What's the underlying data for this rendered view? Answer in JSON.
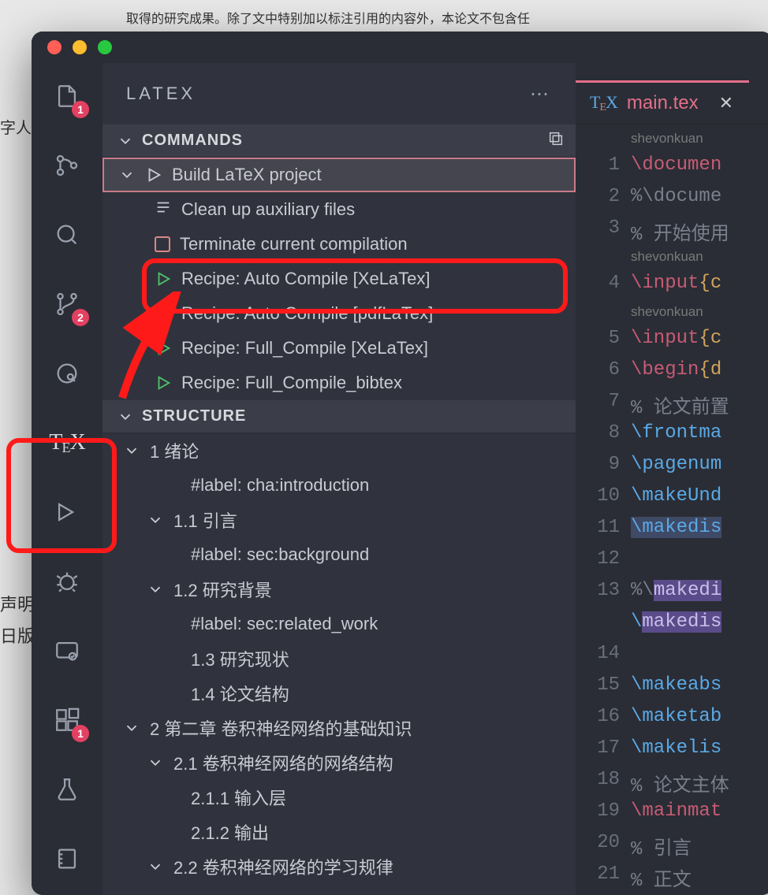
{
  "background_text_top": "取得的研究成果。除了文中特别加以标注引用的内容外，本论文不包含任",
  "background_text_left1": "字人识",
  "background_text_left2": "声明",
  "background_text_left3": "日版",
  "sidebar_title": "LATEX",
  "tab": {
    "filename": "main.tex"
  },
  "activity_badges": {
    "explorer": "1",
    "scm": "2",
    "extensions": "1"
  },
  "commands": {
    "header": "COMMANDS",
    "build": "Build LaTeX project",
    "cleanup": "Clean up auxiliary files",
    "terminate": "Terminate current compilation",
    "recipe_xelatex": "Recipe: Auto Compile [XeLaTex]",
    "recipe_pdflatex": "Recipe: Auto Compile [pdfLaTex]",
    "recipe_full_xelatex": "Recipe: Full_Compile [XeLaTex]",
    "recipe_full_bibtex": "Recipe: Full_Compile_bibtex"
  },
  "structure": {
    "header": "STRUCTURE",
    "items": [
      {
        "depth": 1,
        "chev": true,
        "label": "1 绪论"
      },
      {
        "depth": 3,
        "chev": false,
        "label": "#label: cha:introduction"
      },
      {
        "depth": 2,
        "chev": true,
        "label": "1.1 引言"
      },
      {
        "depth": 3,
        "chev": false,
        "label": "#label: sec:background"
      },
      {
        "depth": 2,
        "chev": true,
        "label": "1.2 研究背景"
      },
      {
        "depth": 3,
        "chev": false,
        "label": "#label: sec:related_work"
      },
      {
        "depth": 3,
        "chev": false,
        "label": "1.3 研究现状"
      },
      {
        "depth": 3,
        "chev": false,
        "label": "1.4 论文结构"
      },
      {
        "depth": 1,
        "chev": true,
        "label": "2 第二章 卷积神经网络的基础知识"
      },
      {
        "depth": 2,
        "chev": true,
        "label": "2.1 卷积神经网络的网络结构"
      },
      {
        "depth": 3,
        "chev": false,
        "label": "2.1.1 输入层"
      },
      {
        "depth": 3,
        "chev": false,
        "label": "2.1.2 输出"
      },
      {
        "depth": 2,
        "chev": true,
        "label": "2.2 卷积神经网络的学习规律"
      }
    ]
  },
  "code": {
    "user": "shevonkuan",
    "lines": [
      {
        "n": "1",
        "t": "\\documen",
        "cls": "cmd2"
      },
      {
        "n": "2",
        "t": "%\\docume",
        "cls": "comment"
      },
      {
        "n": "3",
        "t": "% 开始使用",
        "cls": "comment"
      },
      {
        "n": "",
        "t": "shevonkuan",
        "cls": "user"
      },
      {
        "n": "4",
        "t": "\\input{c",
        "cls": "cmd2-brace"
      },
      {
        "n": "",
        "t": "shevonkuan",
        "cls": "user"
      },
      {
        "n": "5",
        "t": "\\input{c",
        "cls": "cmd2-brace"
      },
      {
        "n": "6",
        "t": "\\begin{d",
        "cls": "cmd2-brace"
      },
      {
        "n": "7",
        "t": "% 论文前置",
        "cls": "comment"
      },
      {
        "n": "8",
        "t": "\\frontma",
        "cls": "cmd"
      },
      {
        "n": "9",
        "t": "\\pagenum",
        "cls": "cmd"
      },
      {
        "n": "10",
        "t": "\\makeUnd",
        "cls": "cmd"
      },
      {
        "n": "11",
        "t": "\\makedis",
        "cls": "cmd-hl"
      },
      {
        "n": "12",
        "t": "",
        "cls": ""
      },
      {
        "n": "13",
        "t": "%\\makedi",
        "cls": "comment-hl"
      },
      {
        "n": "",
        "t": "\\makedis",
        "cls": "cmd-hlpurple-noline"
      },
      {
        "n": "14",
        "t": "",
        "cls": ""
      },
      {
        "n": "15",
        "t": "\\makeabs",
        "cls": "cmd"
      },
      {
        "n": "16",
        "t": "\\maketab",
        "cls": "cmd"
      },
      {
        "n": "17",
        "t": "\\makelis",
        "cls": "cmd"
      },
      {
        "n": "18",
        "t": "% 论文主体",
        "cls": "comment"
      },
      {
        "n": "19",
        "t": "\\mainmat",
        "cls": "cmd2"
      },
      {
        "n": "20",
        "t": "% 引言",
        "cls": "comment"
      },
      {
        "n": "21",
        "t": "% 正文",
        "cls": "comment"
      }
    ]
  }
}
